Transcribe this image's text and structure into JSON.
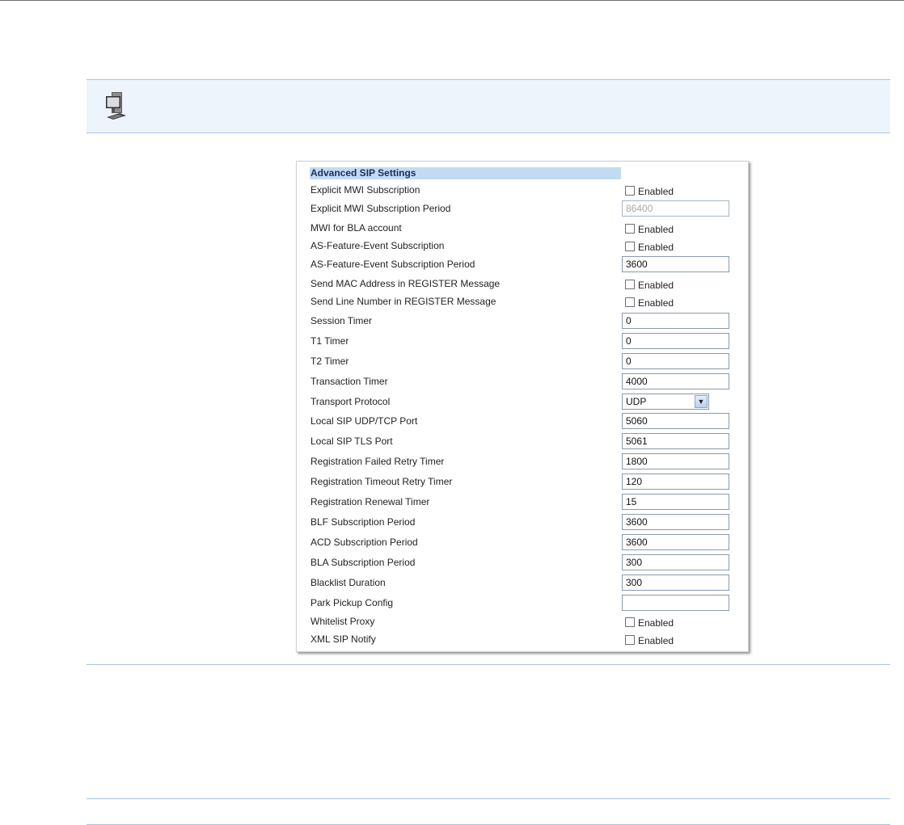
{
  "panel": {
    "title": "Advanced SIP Settings",
    "checkbox_label": "Enabled",
    "rows": [
      {
        "label": "Explicit MWI Subscription",
        "type": "checkbox",
        "checked": false
      },
      {
        "label": "Explicit MWI Subscription Period",
        "type": "text",
        "value": "86400",
        "disabled": true
      },
      {
        "label": "MWI for BLA account",
        "type": "checkbox",
        "checked": false
      },
      {
        "label": "AS-Feature-Event Subscription",
        "type": "checkbox",
        "checked": false
      },
      {
        "label": "AS-Feature-Event Subscription Period",
        "type": "text",
        "value": "3600"
      },
      {
        "label": "Send MAC Address in REGISTER Message",
        "type": "checkbox",
        "checked": false
      },
      {
        "label": "Send Line Number in REGISTER Message",
        "type": "checkbox",
        "checked": false
      },
      {
        "label": "Session Timer",
        "type": "text",
        "value": "0"
      },
      {
        "label": "T1 Timer",
        "type": "text",
        "value": "0"
      },
      {
        "label": "T2 Timer",
        "type": "text",
        "value": "0"
      },
      {
        "label": "Transaction Timer",
        "type": "text",
        "value": "4000"
      },
      {
        "label": "Transport Protocol",
        "type": "select",
        "value": "UDP"
      },
      {
        "label": "Local SIP UDP/TCP Port",
        "type": "text",
        "value": "5060"
      },
      {
        "label": "Local SIP TLS Port",
        "type": "text",
        "value": "5061"
      },
      {
        "label": "Registration Failed Retry Timer",
        "type": "text",
        "value": "1800"
      },
      {
        "label": "Registration Timeout Retry Timer",
        "type": "text",
        "value": "120"
      },
      {
        "label": "Registration Renewal Timer",
        "type": "text",
        "value": "15"
      },
      {
        "label": "BLF Subscription Period",
        "type": "text",
        "value": "3600"
      },
      {
        "label": "ACD Subscription Period",
        "type": "text",
        "value": "3600"
      },
      {
        "label": "BLA Subscription Period",
        "type": "text",
        "value": "300"
      },
      {
        "label": "Blacklist Duration",
        "type": "text",
        "value": "300"
      },
      {
        "label": "Park Pickup Config",
        "type": "text",
        "value": ""
      },
      {
        "label": "Whitelist Proxy",
        "type": "checkbox",
        "checked": false
      },
      {
        "label": "XML SIP Notify",
        "type": "checkbox",
        "checked": false
      }
    ]
  },
  "icons": {
    "note": "computer-icon",
    "dropdown": "chevron-down-icon"
  }
}
